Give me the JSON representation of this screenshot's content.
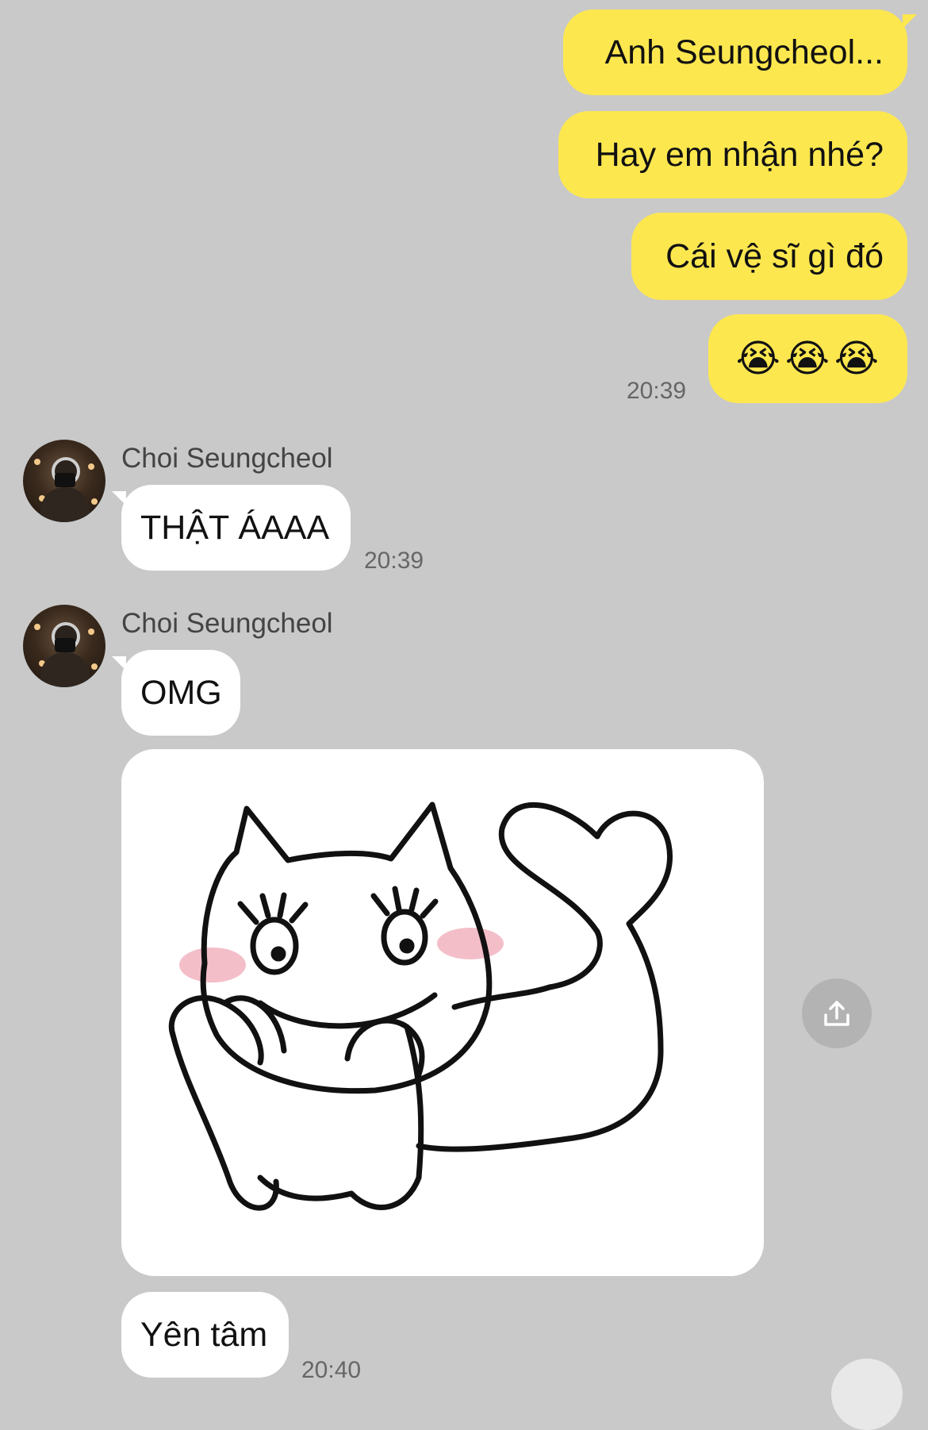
{
  "outgoing": [
    {
      "text": "Anh Seungcheol..."
    },
    {
      "text": "Hay em nhận nhé?"
    },
    {
      "text": "Cái vệ sĩ gì đó"
    },
    {
      "text": "😭😭😭"
    }
  ],
  "outgoing_time": "20:39",
  "incoming": [
    {
      "sender": "Choi Seungcheol",
      "text": "THẬT ÁAAA",
      "time": "20:39"
    },
    {
      "sender": "Choi Seungcheol",
      "text": "OMG"
    },
    {
      "text": "Yên tâm",
      "time": "20:40"
    }
  ],
  "colors": {
    "background": "#c9c9c9",
    "outgoing_bubble": "#fde74f",
    "incoming_bubble": "#ffffff"
  },
  "icons": {
    "share": "share-icon",
    "sticker": "cat-sticker"
  }
}
